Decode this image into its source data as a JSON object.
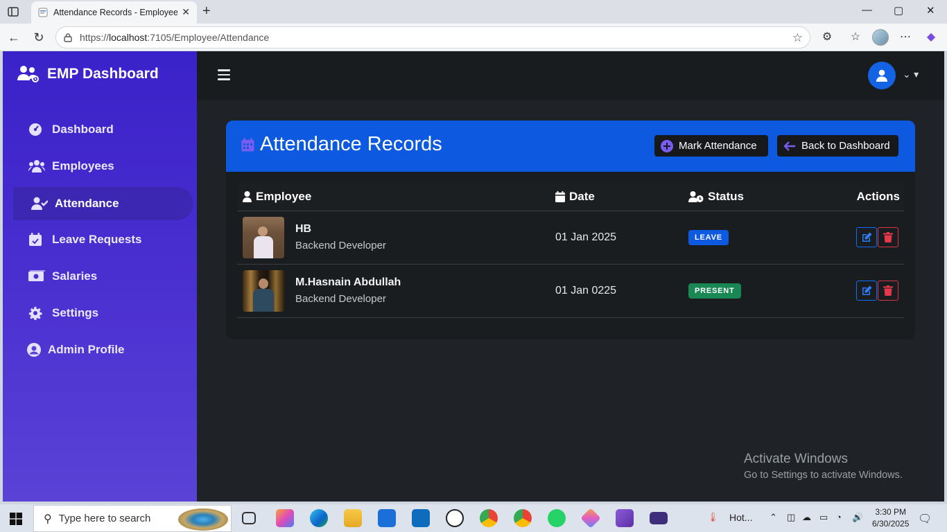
{
  "browser": {
    "tab_title": "Attendance Records - Employee D",
    "tab_close": "✕",
    "new_tab": "+",
    "url_prefix": "https://",
    "url_host": "localhost",
    "url_rest": ":7105/Employee/Attendance",
    "window_controls": [
      "—",
      "▢",
      "✕"
    ]
  },
  "sidebar": {
    "brand": "EMP Dashboard",
    "items": [
      {
        "label": "Dashboard",
        "icon": "gauge-icon"
      },
      {
        "label": "Employees",
        "icon": "users-icon"
      },
      {
        "label": "Attendance",
        "icon": "user-check-icon",
        "active": true
      },
      {
        "label": "Leave Requests",
        "icon": "calendar-check-icon"
      },
      {
        "label": "Salaries",
        "icon": "money-bill-icon"
      },
      {
        "label": "Settings",
        "icon": "gear-icon"
      },
      {
        "label": "Admin Profile",
        "icon": "user-circle-icon"
      }
    ]
  },
  "card": {
    "title": "Attendance Records",
    "mark_attendance": "Mark Attendance",
    "back_to_dashboard": "Back to Dashboard"
  },
  "table": {
    "headers": {
      "employee": "Employee",
      "date": "Date",
      "status": "Status",
      "actions": "Actions"
    },
    "rows": [
      {
        "name": "HB",
        "role": "Backend Developer",
        "date": "01 Jan 2025",
        "status": "LEAVE",
        "status_color": "#0d5ae0"
      },
      {
        "name": "M.Hasnain Abdullah",
        "role": "Backend Developer",
        "date": "01 Jan 0225",
        "status": "PRESENT",
        "status_color": "#198754"
      }
    ]
  },
  "watermark": {
    "line1": "Activate Windows",
    "line2": "Go to Settings to activate Windows."
  },
  "taskbar": {
    "search_placeholder": "Type here to search",
    "weather": "Hot...",
    "time": "3:30 PM",
    "date": "6/30/2025"
  },
  "colors": {
    "sidebar_top": "#3a22c9",
    "accent_blue": "#0d5ae0",
    "danger_red": "#dc3545",
    "success_green": "#198754",
    "background_dark": "#1f2327"
  }
}
